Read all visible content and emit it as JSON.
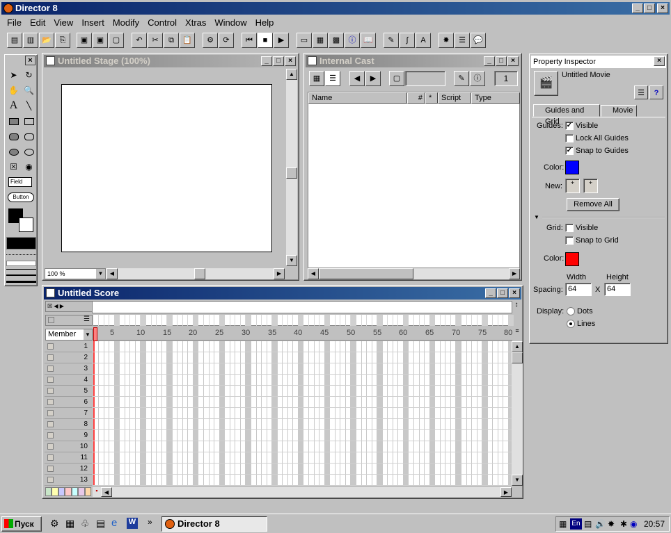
{
  "app": {
    "title": "Director 8"
  },
  "menu": [
    "File",
    "Edit",
    "View",
    "Insert",
    "Modify",
    "Control",
    "Xtras",
    "Window",
    "Help"
  ],
  "stage": {
    "title": "Untitled Stage (100%)",
    "zoom": "100 %"
  },
  "cast": {
    "title": "Internal Cast",
    "number": "1",
    "columns": [
      "Name",
      "#",
      "*",
      "Script",
      "Type"
    ]
  },
  "score": {
    "title": "Untitled Score",
    "member_label": "Member",
    "frame_numbers": [
      "5",
      "10",
      "15",
      "20",
      "25",
      "30",
      "35",
      "40",
      "45",
      "50",
      "55",
      "60",
      "65",
      "70",
      "75",
      "80"
    ],
    "channels": [
      "1",
      "2",
      "3",
      "4",
      "5",
      "6",
      "7",
      "8",
      "9",
      "10",
      "11",
      "12",
      "13"
    ],
    "palette_colors": [
      "#c8e6c8",
      "#ffffb0",
      "#c8c8ff",
      "#ffc8c8",
      "#c8ffff",
      "#e8c8e8",
      "#ffd8a8"
    ]
  },
  "tools": {
    "field_label": "Field",
    "button_label": "Button"
  },
  "inspector": {
    "title": "Property Inspector",
    "subject": "Untitled Movie",
    "tabs": [
      "Guides and Grid",
      "Movie"
    ],
    "guides_label": "Guides:",
    "guides_visible": "Visible",
    "lock_all": "Lock All Guides",
    "snap_guides": "Snap to Guides",
    "color_label": "Color:",
    "new_label": "New:",
    "remove_all": "Remove All",
    "grid_label": "Grid:",
    "grid_visible": "Visible",
    "snap_grid": "Snap to Grid",
    "grid_color_label": "Color:",
    "width_label": "Width",
    "height_label": "Height",
    "spacing_label": "Spacing:",
    "x_label": "X",
    "width": "64",
    "height": "64",
    "display_label": "Display:",
    "dots": "Dots",
    "lines": "Lines",
    "guide_color": "#0000ff",
    "grid_color": "#ff0000"
  },
  "taskbar": {
    "start": "Пуск",
    "chevron": "»",
    "task": "Director 8",
    "lang": "En",
    "clock": "20:57"
  }
}
